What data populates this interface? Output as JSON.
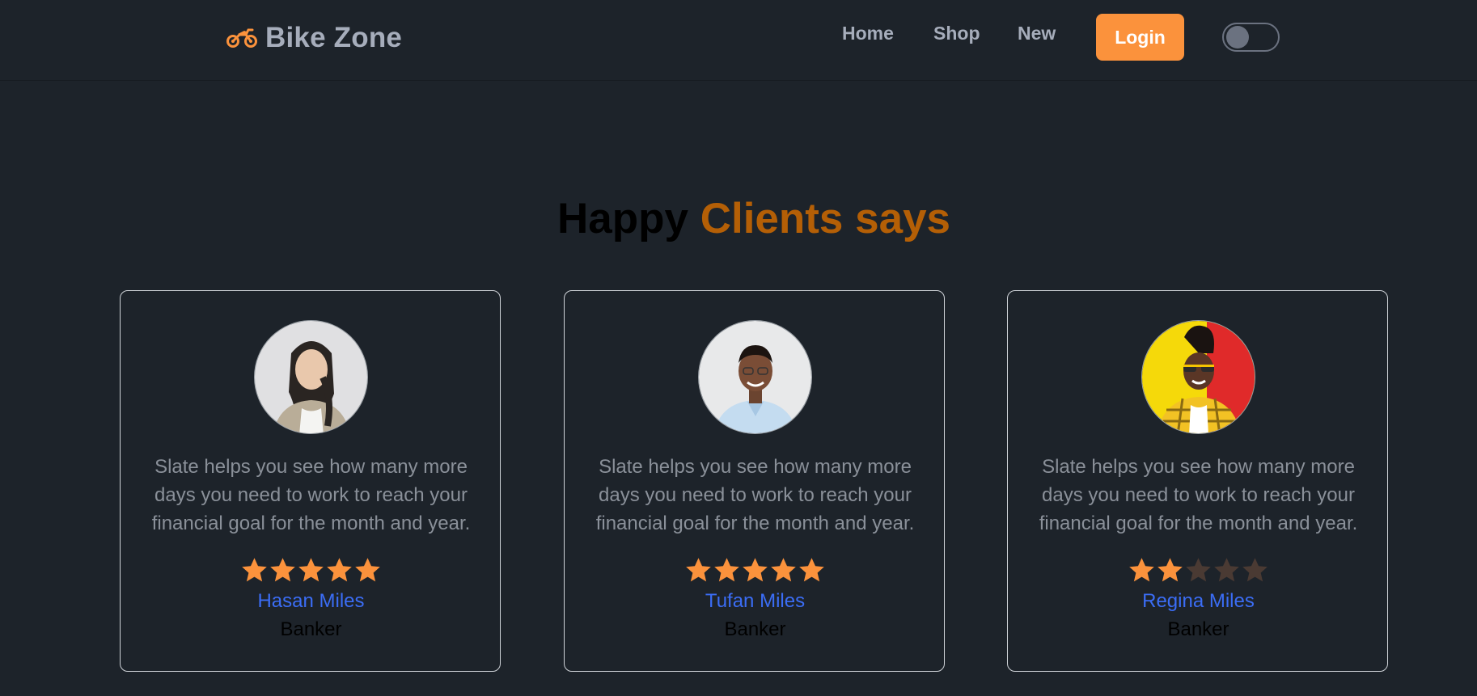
{
  "brand": {
    "name": "Bike Zone",
    "icon": "motorcycle-icon",
    "icon_color": "#fb923c"
  },
  "nav": {
    "home": "Home",
    "shop": "Shop",
    "new": "New",
    "login": "Login"
  },
  "colors": {
    "background": "#1d232a",
    "accent": "#fb923c",
    "title_accent": "#b45f06",
    "name_color": "#3b6df5"
  },
  "section": {
    "title_part1": "Happy",
    "title_part2": "Clients says"
  },
  "testimonials": [
    {
      "avatar_icon": "portrait-woman-gray-background",
      "quote": "Slate helps you see how many more days you need to work to reach your financial goal for the month and year.",
      "rating": 5,
      "rating_max": 5,
      "name": "Hasan Miles",
      "role": "Banker"
    },
    {
      "avatar_icon": "portrait-man-light-background",
      "quote": "Slate helps you see how many more days you need to work to reach your financial goal for the month and year.",
      "rating": 5,
      "rating_max": 5,
      "name": "Tufan Miles",
      "role": "Banker"
    },
    {
      "avatar_icon": "portrait-woman-yellow-red-background",
      "quote": "Slate helps you see how many more days you need to work to reach your financial goal for the month and year.",
      "rating": 2,
      "rating_max": 5,
      "name": "Regina Miles",
      "role": "Banker"
    }
  ]
}
